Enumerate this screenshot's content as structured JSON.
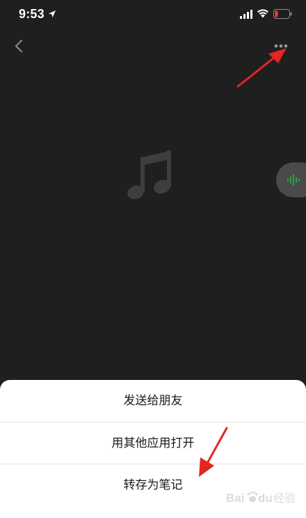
{
  "status_bar": {
    "time": "9:53"
  },
  "toolbar": {
    "back_icon": "chevron-left-icon",
    "more_icon": "more-dots-icon"
  },
  "content": {
    "icon": "music-note-icon"
  },
  "floating_button": {
    "icon": "voice-wave-icon",
    "accent": "#2ea043"
  },
  "action_sheet": {
    "items": [
      {
        "label": "发送给朋友"
      },
      {
        "label": "用其他应用打开"
      },
      {
        "label": "转存为笔记"
      }
    ]
  },
  "watermark": {
    "brand": "Baidu",
    "suffix": "经验"
  },
  "colors": {
    "background": "#1f1f1f",
    "annotation_arrow": "#e52520",
    "sheet": "#ffffff"
  }
}
